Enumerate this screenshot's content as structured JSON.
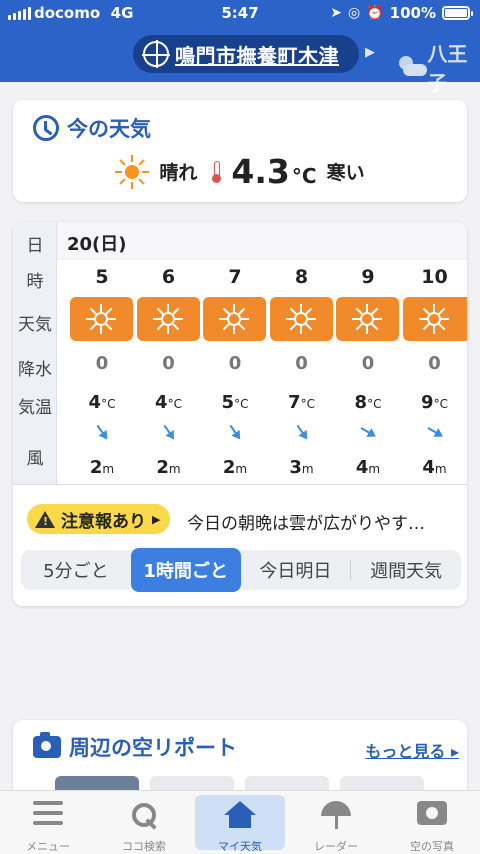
{
  "status": {
    "carrier": "docomo",
    "network": "4G",
    "time": "5:47",
    "battery": "100%"
  },
  "header": {
    "location": "鳴門市撫養町木津",
    "next_location": "八王子"
  },
  "now": {
    "title": "今の天気",
    "weather": "晴れ",
    "temperature": "4.3",
    "unit": "°C",
    "feel": "寒い",
    "icon": "sun-icon"
  },
  "forecast": {
    "labels": {
      "day": "日",
      "hour": "時",
      "weather": "天気",
      "precip": "降水",
      "temp": "気温",
      "wind": "風"
    },
    "day": "20(日)",
    "hours": [
      {
        "hour": "5",
        "weather_icon": "sun-icon",
        "precip": "0",
        "temp": "4",
        "temp_unit": "°C",
        "wind": "2",
        "wind_unit": "m"
      },
      {
        "hour": "6",
        "weather_icon": "sun-icon",
        "precip": "0",
        "temp": "4",
        "temp_unit": "°C",
        "wind": "2",
        "wind_unit": "m"
      },
      {
        "hour": "7",
        "weather_icon": "sun-icon",
        "precip": "0",
        "temp": "5",
        "temp_unit": "°C",
        "wind": "2",
        "wind_unit": "m"
      },
      {
        "hour": "8",
        "weather_icon": "sun-icon",
        "precip": "0",
        "temp": "7",
        "temp_unit": "°C",
        "wind": "3",
        "wind_unit": "m"
      },
      {
        "hour": "9",
        "weather_icon": "sun-icon",
        "precip": "0",
        "temp": "8",
        "temp_unit": "°C",
        "wind": "4",
        "wind_unit": "m"
      },
      {
        "hour": "10",
        "weather_icon": "sun-icon",
        "precip": "0",
        "temp": "9",
        "temp_unit": "°C",
        "wind": "4",
        "wind_unit": "m"
      }
    ],
    "alert_label": "注意報あり",
    "alert_text": "今日の朝晩は雲が広がりやす…",
    "segments": [
      "5分ごと",
      "1時間ごと",
      "今日明日",
      "週間天気"
    ],
    "active_segment": "1時間ごと"
  },
  "report": {
    "title": "周辺の空リポート",
    "more": "もっと見る"
  },
  "nav": [
    {
      "label": "メニュー",
      "icon": "menu-icon"
    },
    {
      "label": "ココ検索",
      "icon": "search-icon"
    },
    {
      "label": "マイ天気",
      "icon": "home-icon"
    },
    {
      "label": "レーダー",
      "icon": "radar-icon"
    },
    {
      "label": "空の写真",
      "icon": "camera-icon"
    }
  ],
  "colors": {
    "header": "#2b63c8",
    "accent": "#2a5fb8",
    "sun": "#f7931e",
    "weather_box": "#f08a2b",
    "alert": "#f9d84a",
    "active_segment": "#3d7fe0"
  }
}
